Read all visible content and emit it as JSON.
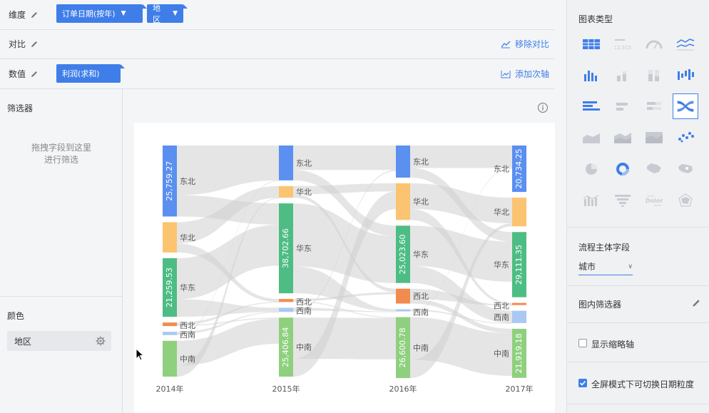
{
  "config": {
    "dimension": {
      "label": "维度",
      "pills": [
        "订单日期(按年)",
        "地区"
      ]
    },
    "compare": {
      "label": "对比",
      "action": "移除对比"
    },
    "value": {
      "label": "数值",
      "pill": "利润(求和)",
      "action": "添加次轴"
    }
  },
  "filter": {
    "title": "筛选器",
    "hint_line1": "拖拽字段到这里",
    "hint_line2": "进行筛选"
  },
  "color": {
    "title": "颜色",
    "field": "地区"
  },
  "right_panel": {
    "chart_type_title": "图表类型",
    "chart_type_icons": [
      "table-icon",
      "kpi-number-icon",
      "gauge-icon",
      "line-chart-icon",
      "bar-chart-icon",
      "stacked-bar-icon",
      "percent-bar-icon",
      "waterfall-icon",
      "horizontal-bar-icon",
      "horizontal-stacked-bar-icon",
      "horizontal-percent-bar-icon",
      "sankey-icon",
      "area-chart-icon",
      "stacked-area-icon",
      "percent-area-icon",
      "scatter-icon",
      "pie-chart-icon",
      "ring-chart-icon",
      "map-icon",
      "region-map-icon",
      "combo-chart-icon",
      "funnel-icon",
      "word-cloud-icon",
      "radar-icon"
    ],
    "kpi_sample": "12,515",
    "wordcloud_sample": "Dolor",
    "flow_field_label": "流程主体字段",
    "flow_field_value": "城市",
    "in_chart_filter_label": "图内筛选器",
    "thumbnail_axis_label": "显示缩略轴",
    "thumbnail_axis_checked": false,
    "fullscreen_granularity_label": "全屏模式下可切换日期粒度",
    "fullscreen_granularity_checked": true
  },
  "colors": {
    "accent": "#3f7ee8",
    "东北": "#5b8ff0",
    "华北": "#fbc471",
    "华东": "#4dbd83",
    "西北": "#f28c4e",
    "西南": "#a9c8f2",
    "中南": "#8fd07e",
    "flow": "#d0d0d0"
  },
  "chart_data": {
    "type": "sankey",
    "years": [
      "2014年",
      "2015年",
      "2016年",
      "2017年"
    ],
    "regions": [
      "东北",
      "华北",
      "华东",
      "西北",
      "西南",
      "中南"
    ],
    "values": {
      "2014年": {
        "东北": 25759.27,
        "华北": 11000,
        "华东": 21259.53,
        "西北": 1300,
        "西南": 1200,
        "中南": 13000
      },
      "2015年": {
        "东北": 15000,
        "华北": 5000,
        "华东": 38702.66,
        "西北": 1300,
        "西南": 1800,
        "中南": 25406.84
      },
      "2016年": {
        "东北": 14000,
        "华北": 16000,
        "华东": 25023.6,
        "西北": 6500,
        "西南": 300,
        "中南": 26600.78
      },
      "2017年": {
        "东北": 20734.25,
        "华北": 12800,
        "华东": 29111.35,
        "西北": 400,
        "西南": 5500,
        "中南": 21919.18
      }
    },
    "value_labels": {
      "2014年": {
        "东北": "25,759.27",
        "华东": "21,259.53"
      },
      "2015年": {
        "华东": "38,702.66",
        "中南": "25,406.84"
      },
      "2016年": {
        "华东": "25,023.60",
        "中南": "26,600.78"
      },
      "2017年": {
        "东北": "20,734.25",
        "华东": "29,111.35",
        "中南": "21,919.18"
      }
    }
  }
}
